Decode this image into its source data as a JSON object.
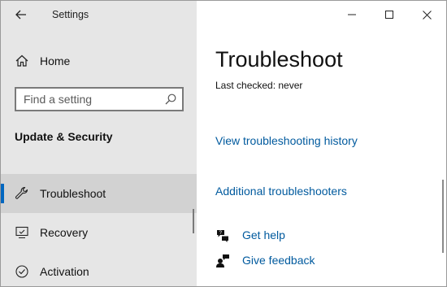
{
  "window": {
    "title": "Settings",
    "controls": {
      "minimize": "minimize",
      "maximize": "maximize",
      "close": "close"
    }
  },
  "sidebar": {
    "home_label": "Home",
    "search": {
      "placeholder": "Find a setting",
      "value": ""
    },
    "section_title": "Update & Security",
    "items": [
      {
        "label": "Troubleshoot",
        "icon": "wrench-icon",
        "active": true
      },
      {
        "label": "Recovery",
        "icon": "recovery-icon",
        "active": false
      },
      {
        "label": "Activation",
        "icon": "activation-icon",
        "active": false
      }
    ]
  },
  "main": {
    "title": "Troubleshoot",
    "last_checked": "Last checked: never",
    "history_link": "View troubleshooting history",
    "additional_link": "Additional troubleshooters",
    "help": {
      "get_help": "Get help",
      "give_feedback": "Give feedback"
    }
  },
  "colors": {
    "accent": "#0067c0",
    "link": "#005a9e",
    "sidebar_bg": "#e6e6e6",
    "active_item_bg": "#d2d2d2"
  }
}
